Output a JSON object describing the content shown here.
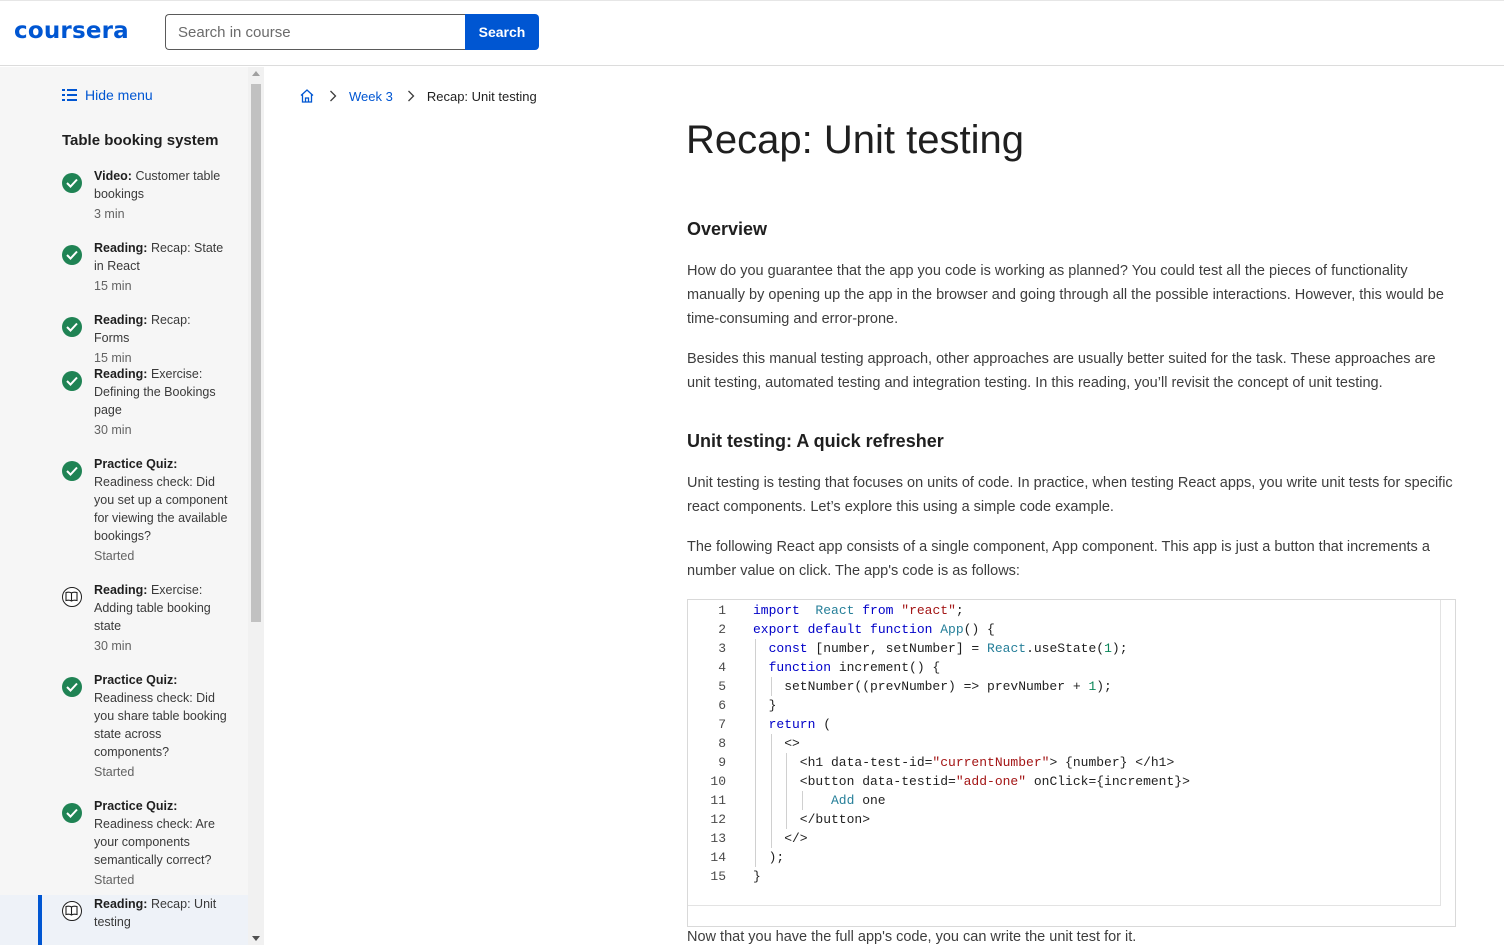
{
  "header": {
    "logo": "coursera",
    "search_placeholder": "Search in course",
    "search_button": "Search"
  },
  "sidebar": {
    "hide_menu": "Hide menu",
    "module_title": "Table booking system",
    "items": [
      {
        "type": "Video:",
        "title": " Customer table bookings",
        "meta": "3 min",
        "status": "completed",
        "icon": "check-circle-icon"
      },
      {
        "type": "Reading:",
        "title": " Recap: State in React",
        "meta": "15 min",
        "status": "completed",
        "icon": "check-circle-icon"
      },
      {
        "type": "Reading:",
        "title": " Recap: Forms",
        "meta": "15 min",
        "status": "completed",
        "icon": "check-circle-icon"
      },
      {
        "type": "Reading:",
        "title": " Exercise: Defining the Bookings page",
        "meta": "30 min",
        "status": "completed",
        "icon": "check-circle-icon"
      },
      {
        "type": "Practice Quiz:",
        "title": " Readiness check: Did you set up a component for viewing the available bookings?",
        "meta": "Started",
        "status": "completed",
        "icon": "check-circle-icon"
      },
      {
        "type": "Reading:",
        "title": " Exercise: Adding table booking state",
        "meta": "30 min",
        "status": "not-started",
        "icon": "book-icon"
      },
      {
        "type": "Practice Quiz:",
        "title": " Readiness check: Did you share table booking state across components?",
        "meta": "Started",
        "status": "completed",
        "icon": "check-circle-icon"
      },
      {
        "type": "Practice Quiz:",
        "title": " Readiness check: Are your components semantically correct?",
        "meta": "Started",
        "status": "completed",
        "icon": "check-circle-icon"
      },
      {
        "type": "Reading:",
        "title": " Recap: Unit testing",
        "meta": "",
        "status": "active",
        "icon": "book-icon"
      }
    ]
  },
  "breadcrumb": {
    "week": "Week 3",
    "current": "Recap: Unit testing"
  },
  "main": {
    "title": "Recap: Unit testing",
    "overview_heading": "Overview",
    "overview_p1": "How do you guarantee that the app you code is working as planned? You could test all the pieces of functionality manually by opening up the app in the browser and going through all the possible interactions. However, this would be time-consuming and error-prone.",
    "overview_p2": "Besides this manual testing approach, other approaches are usually better suited for the task.  These approaches are unit testing, automated testing and integration testing. In this reading, you’ll revisit the concept of unit testing.",
    "unit_heading": "Unit testing: A quick refresher",
    "unit_p1": "Unit testing is testing that focuses on units of code. In practice, when testing React apps, you write unit tests for specific react components. Let’s explore this using a simple code example.",
    "unit_p2": "The following React app consists of a single component, App component. This app is just a button that increments a number value on click. The app's code is as follows:",
    "after_code": "Now that you have the full app's code, you can write the unit test for it."
  },
  "code": {
    "lines": [
      {
        "n": "1",
        "indent": 0,
        "tokens": [
          [
            "kw",
            "import"
          ],
          [
            "",
            "  "
          ],
          [
            "tp",
            "React"
          ],
          [
            "",
            " "
          ],
          [
            "kw",
            "from"
          ],
          [
            "",
            " "
          ],
          [
            "str",
            "\"react\""
          ],
          [
            "",
            ";"
          ]
        ]
      },
      {
        "n": "2",
        "indent": 0,
        "tokens": [
          [
            "kw",
            "export default function"
          ],
          [
            "",
            " "
          ],
          [
            "tp",
            "App"
          ],
          [
            "",
            "() {"
          ]
        ]
      },
      {
        "n": "3",
        "indent": 1,
        "tokens": [
          [
            "kw",
            "const"
          ],
          [
            "",
            " [number, setNumber] = "
          ],
          [
            "tp",
            "React"
          ],
          [
            "",
            ".useState("
          ],
          [
            "num",
            "1"
          ],
          [
            "",
            ");"
          ]
        ]
      },
      {
        "n": "4",
        "indent": 1,
        "tokens": [
          [
            "kw",
            "function"
          ],
          [
            "",
            " increment() {"
          ]
        ]
      },
      {
        "n": "5",
        "indent": 2,
        "tokens": [
          [
            "",
            "setNumber((prevNumber) => prevNumber + "
          ],
          [
            "num",
            "1"
          ],
          [
            "",
            ");"
          ]
        ]
      },
      {
        "n": "6",
        "indent": 1,
        "tokens": [
          [
            "",
            "}"
          ]
        ]
      },
      {
        "n": "7",
        "indent": 1,
        "tokens": [
          [
            "kw",
            "return"
          ],
          [
            "",
            " ("
          ]
        ]
      },
      {
        "n": "8",
        "indent": 2,
        "tokens": [
          [
            "",
            "<>"
          ]
        ]
      },
      {
        "n": "9",
        "indent": 3,
        "tokens": [
          [
            "",
            "<h1 data-test-id="
          ],
          [
            "str",
            "\"currentNumber\""
          ],
          [
            "",
            "> {number} </h1>"
          ]
        ]
      },
      {
        "n": "10",
        "indent": 3,
        "tokens": [
          [
            "",
            "<button data-testid="
          ],
          [
            "str",
            "\"add-one\""
          ],
          [
            "",
            " onClick={increment}>"
          ]
        ]
      },
      {
        "n": "11",
        "indent": 5,
        "tokens": [
          [
            "tp",
            "Add"
          ],
          [
            "",
            " one"
          ]
        ]
      },
      {
        "n": "12",
        "indent": 3,
        "tokens": [
          [
            "",
            "</button>"
          ]
        ]
      },
      {
        "n": "13",
        "indent": 2,
        "tokens": [
          [
            "",
            "</>"
          ]
        ]
      },
      {
        "n": "14",
        "indent": 1,
        "tokens": [
          [
            "",
            ");"
          ]
        ]
      },
      {
        "n": "15",
        "indent": 0,
        "tokens": [
          [
            "",
            "}"
          ]
        ]
      }
    ]
  },
  "colors": {
    "brand": "#0056d2",
    "completed": "#1f8354"
  }
}
